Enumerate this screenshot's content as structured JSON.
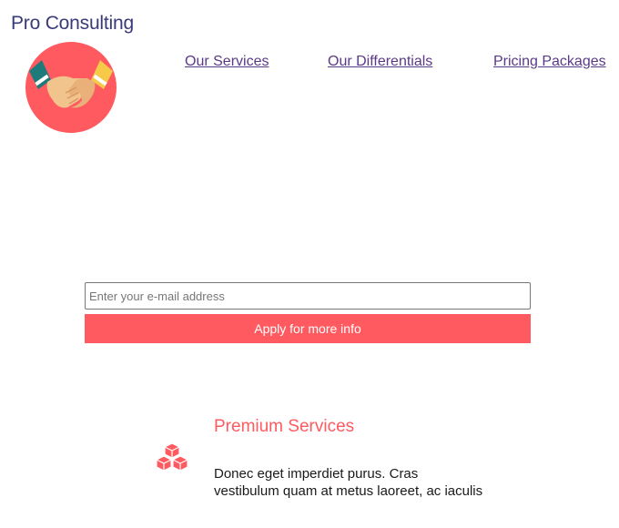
{
  "brand": {
    "name": "Pro Consulting"
  },
  "logo": {
    "icon": "handshake-icon"
  },
  "nav": {
    "items": [
      {
        "label": "Our Services"
      },
      {
        "label": "Our Differentials"
      },
      {
        "label": "Pricing Packages"
      }
    ]
  },
  "signup": {
    "email_placeholder": "Enter your e-mail address",
    "email_value": "",
    "submit_label": "Apply for more info"
  },
  "feature": {
    "icon": "cubes-icon",
    "title": "Premium Services",
    "text": "Donec eget imperdiet purus. Cras vestibulum quam at metus laoreet, ac iaculis"
  },
  "colors": {
    "accent": "#ff5a60",
    "brand_text": "#3a3a7a",
    "link": "#5a3a86"
  }
}
